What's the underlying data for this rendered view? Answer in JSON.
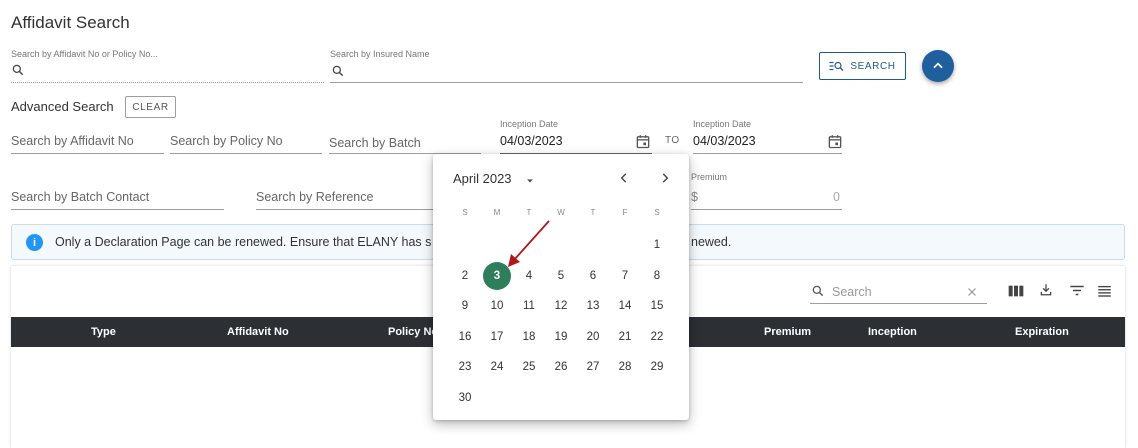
{
  "page": {
    "title": "Affidavit Search"
  },
  "basic_search": {
    "affidavit_label": "Search by Affidavit No or Policy No...",
    "insured_label": "Search by Insured Name",
    "search_button": "SEARCH"
  },
  "advanced": {
    "title": "Advanced Search",
    "clear_button": "CLEAR",
    "affidavit_no": "Search by Affidavit No",
    "policy_no": "Search by Policy No",
    "batch": "Search by Batch",
    "inception_from_label": "Inception Date",
    "inception_from_value": "04/03/2023",
    "to_label": "TO",
    "inception_to_label": "Inception Date",
    "inception_to_value": "04/03/2023",
    "batch_contact": "Search by Batch Contact",
    "reference": "Search by Reference",
    "premium_label": "Premium",
    "premium_prefix": "$",
    "premium_value": "0"
  },
  "banner": {
    "text_left": "Only a Declaration Page can be renewed. Ensure that ELANY has s",
    "text_right": "newed."
  },
  "table": {
    "search_placeholder": "Search",
    "columns": [
      "Type",
      "Affidavit No",
      "Policy No",
      "Premium",
      "Inception",
      "Expiration"
    ]
  },
  "calendar": {
    "month_label": "April 2023",
    "weekdays": [
      "S",
      "M",
      "T",
      "W",
      "T",
      "F",
      "S"
    ],
    "selected_day": "3",
    "weeks": [
      [
        "",
        "",
        "",
        "",
        "",
        "",
        "1"
      ],
      [
        "2",
        "3",
        "4",
        "5",
        "6",
        "7",
        "8"
      ],
      [
        "9",
        "10",
        "11",
        "12",
        "13",
        "14",
        "15"
      ],
      [
        "16",
        "17",
        "18",
        "19",
        "20",
        "21",
        "22"
      ],
      [
        "23",
        "24",
        "25",
        "26",
        "27",
        "28",
        "29"
      ],
      [
        "30",
        "",
        "",
        "",
        "",
        "",
        ""
      ]
    ]
  },
  "colors": {
    "primary": "#1f5f9e",
    "selected_day": "#2e7d5b",
    "header_dark": "#2c3034",
    "info": "#2196f3",
    "arrow": "#b0161c"
  },
  "icons": [
    "search-icon",
    "chevron-up-icon",
    "calendar-icon",
    "dropdown-arrow-icon",
    "chevron-left-icon",
    "chevron-right-icon",
    "info-icon",
    "close-icon",
    "columns-icon",
    "download-icon",
    "filter-icon",
    "density-icon"
  ]
}
